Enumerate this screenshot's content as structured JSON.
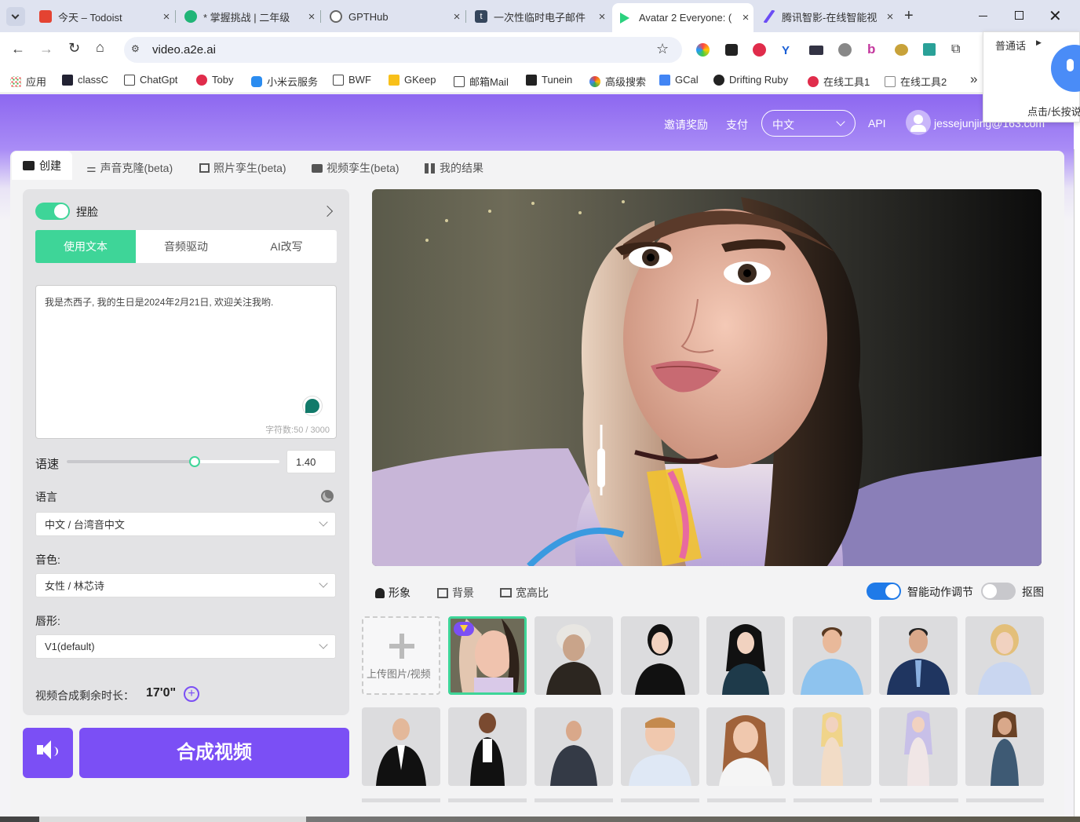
{
  "browser": {
    "tabs": [
      {
        "title": "今天 – Todoist",
        "color": "#e44332"
      },
      {
        "title": "* 掌握挑战 | 二年级",
        "color": "#21b577"
      },
      {
        "title": "GPTHub",
        "color": "#666"
      },
      {
        "title": "一次性临时电子邮件",
        "color": "#35465c"
      },
      {
        "title": "Avatar 2 Everyone: (",
        "color": "#2bd17e"
      },
      {
        "title": "腾讯智影-在线智能视",
        "color": "#6b4cf5"
      }
    ],
    "new_tab_symbol": "+",
    "url": "video.a2e.ai",
    "bookmarks": [
      "应用",
      "classC",
      "ChatGpt",
      "Toby",
      "小米云服务",
      "BWF",
      "GKeep",
      "邮箱Mail",
      "Tunein",
      "高级搜索",
      "GCal",
      "Drifting Ruby",
      "在线工具1",
      "在线工具2"
    ],
    "overflow": "»"
  },
  "voice_popup": {
    "lang": "普通话",
    "hint": "点击/长按说"
  },
  "header": {
    "invite": "邀请奖励",
    "pay": "支付",
    "language": "中文",
    "api": "API",
    "user": "jessejunjing@163.com"
  },
  "tabs": [
    "创建",
    "声音克隆(beta)",
    "照片孪生(beta)",
    "视频孪生(beta)",
    "我的结果"
  ],
  "left": {
    "face_swap": "捏脸",
    "modes": [
      "使用文本",
      "音频驱动",
      "AI改写"
    ],
    "text": "我是杰西子, 我的生日是2024年2月21日, 欢迎关注我哟.",
    "char_count": "字符数:50 / 3000",
    "speed_label": "语速",
    "speed_value": "1.40",
    "speed_fraction": 0.6,
    "language_label": "语言",
    "language_value": "中文 / 台湾音中文",
    "voice_label": "音色:",
    "voice_value": "女性 / 林芯诗",
    "lip_label": "唇形:",
    "lip_value": "V1(default)",
    "remaining_label": "视频合成剩余时长：",
    "remaining_value": "17'0\"",
    "generate": "合成视频"
  },
  "right": {
    "subtabs": [
      "形象",
      "背景",
      "宽高比"
    ],
    "smart_motion": "智能动作调节",
    "cutout": "抠图",
    "upload": "上传图片/视频"
  },
  "colors": {
    "accent": "#7b4ff5",
    "green": "#3ed598",
    "blue": "#1f7ae8"
  }
}
